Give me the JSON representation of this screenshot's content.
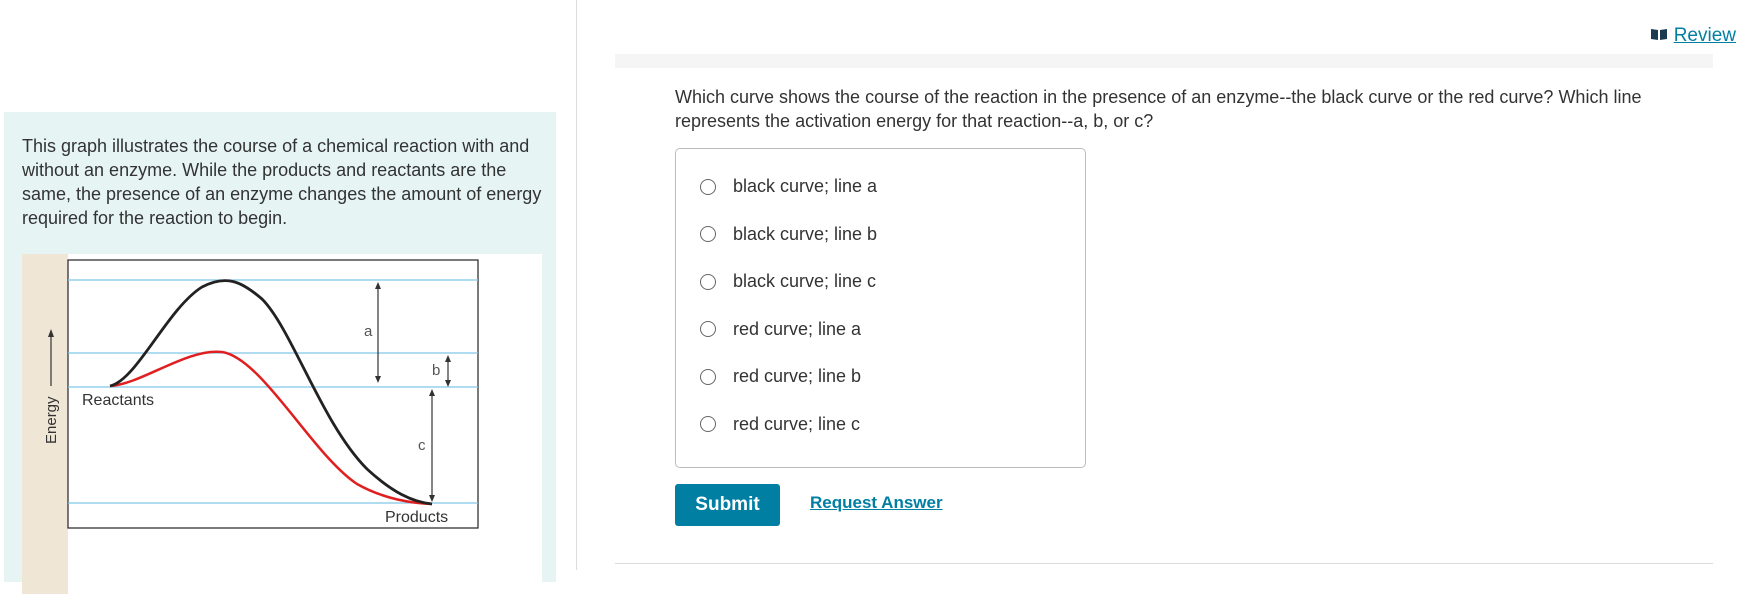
{
  "left_panel": {
    "description": "This graph illustrates the course of a chemical reaction with and without an enzyme. While the products and reactants are the same, the presence of an enzyme changes the amount of energy required for the reaction to begin.",
    "figure": {
      "y_axis_label": "Energy",
      "reactants_label": "Reactants",
      "products_label": "Products",
      "line_a_label": "a",
      "line_b_label": "b",
      "line_c_label": "c",
      "colors": {
        "uncatalyzed_curve": "#222222",
        "catalyzed_curve": "#e02020",
        "guide_lines": "#7fc8e8",
        "axis_band": "#f0e6d6"
      }
    }
  },
  "header": {
    "review_label": "Review",
    "review_icon": "book-icon"
  },
  "question": {
    "text": "Which curve shows the course of the reaction in the presence of an enzyme--the black curve or the red curve? Which line represents the activation energy for that reaction--a, b, or c?",
    "options": [
      {
        "label": "black curve; line a"
      },
      {
        "label": "black curve; line b"
      },
      {
        "label": "black curve; line c"
      },
      {
        "label": "red curve; line a"
      },
      {
        "label": "red curve; line b"
      },
      {
        "label": "red curve; line c"
      }
    ]
  },
  "actions": {
    "submit_label": "Submit",
    "request_answer_label": "Request Answer"
  }
}
